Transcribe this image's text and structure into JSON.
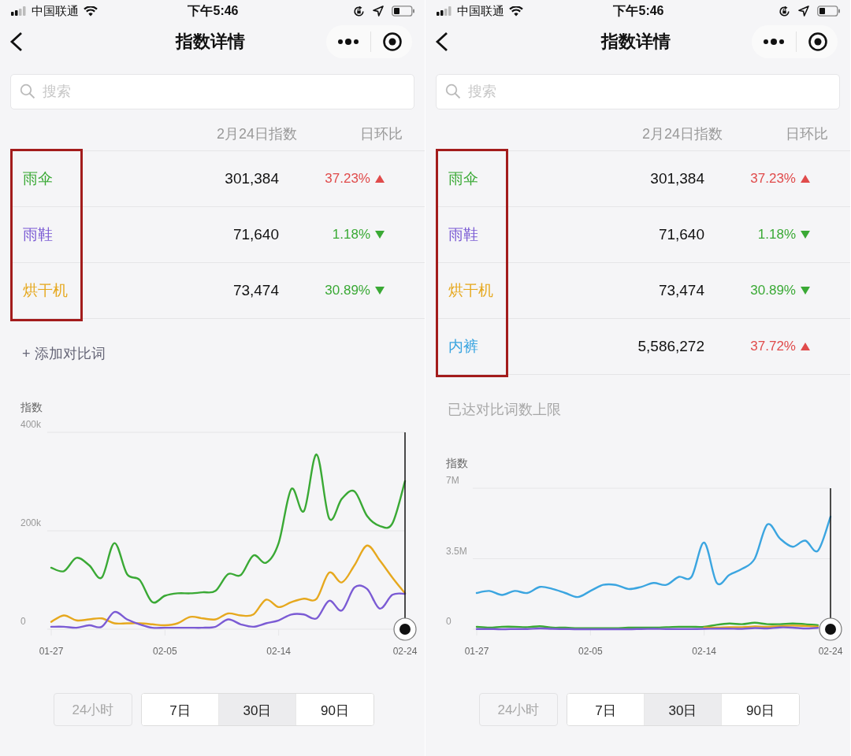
{
  "screens": [
    {
      "status_bar": {
        "carrier": "中国联通",
        "time": "下午5:46"
      },
      "nav": {
        "title": "指数详情"
      },
      "search": {
        "placeholder": "搜索"
      },
      "table": {
        "columns": [
          "2月24日指数",
          "日环比"
        ],
        "highlight_names": true,
        "rows": [
          {
            "name": "雨伞",
            "color": "#3aa935",
            "value": "301,384",
            "change": "37.23%",
            "rising": true
          },
          {
            "name": "雨鞋",
            "color": "#7b5bd4",
            "value": "71,640",
            "change": "1.18%",
            "rising": false
          },
          {
            "name": "烘干机",
            "color": "#e6a81e",
            "value": "73,474",
            "change": "30.89%",
            "rising": false
          }
        ]
      },
      "note": {
        "kind": "add",
        "text": "+ 添加对比词"
      },
      "chart": {
        "chart_data": {
          "type": "line",
          "ylabel": "指数",
          "ylim": [
            0,
            400
          ],
          "categories": [
            "01-27",
            null,
            null,
            null,
            null,
            null,
            null,
            null,
            null,
            "02-05",
            null,
            null,
            null,
            null,
            null,
            null,
            null,
            null,
            "02-14",
            null,
            null,
            null,
            null,
            null,
            null,
            null,
            null,
            null,
            "02-24"
          ],
          "yticks": [
            {
              "value": 0,
              "label": "0"
            },
            {
              "value": 200,
              "label": "200k"
            },
            {
              "value": 400,
              "label": "400k"
            }
          ],
          "series": [
            {
              "color": "#3aa935",
              "values": [
                125,
                118,
                145,
                130,
                105,
                175,
                112,
                100,
                55,
                68,
                73,
                73,
                75,
                78,
                112,
                110,
                150,
                135,
                175,
                285,
                240,
                355,
                225,
                265,
                280,
                230,
                210,
                215,
                301
              ]
            },
            {
              "color": "#e6a81e",
              "values": [
                15,
                28,
                18,
                20,
                22,
                12,
                12,
                12,
                10,
                8,
                12,
                25,
                22,
                20,
                32,
                28,
                30,
                60,
                45,
                55,
                62,
                62,
                115,
                95,
                130,
                170,
                140,
                105,
                73
              ]
            },
            {
              "color": "#7b5bd4",
              "values": [
                5,
                5,
                3,
                8,
                5,
                35,
                20,
                10,
                3,
                3,
                3,
                3,
                3,
                5,
                20,
                10,
                5,
                12,
                18,
                30,
                30,
                22,
                58,
                38,
                85,
                82,
                42,
                70,
                72
              ]
            }
          ]
        }
      },
      "ranges": [
        {
          "label": "24小时",
          "selected": false,
          "disabled": true
        },
        {
          "label": "7日",
          "selected": false,
          "disabled": false
        },
        {
          "label": "30日",
          "selected": true,
          "disabled": false
        },
        {
          "label": "90日",
          "selected": false,
          "disabled": false
        }
      ]
    },
    {
      "status_bar": {
        "carrier": "中国联通",
        "time": "下午5:46"
      },
      "nav": {
        "title": "指数详情"
      },
      "search": {
        "placeholder": "搜索"
      },
      "table": {
        "columns": [
          "2月24日指数",
          "日环比"
        ],
        "highlight_names": true,
        "rows": [
          {
            "name": "雨伞",
            "color": "#3aa935",
            "value": "301,384",
            "change": "37.23%",
            "rising": true
          },
          {
            "name": "雨鞋",
            "color": "#7b5bd4",
            "value": "71,640",
            "change": "1.18%",
            "rising": false
          },
          {
            "name": "烘干机",
            "color": "#e6a81e",
            "value": "73,474",
            "change": "30.89%",
            "rising": false
          },
          {
            "name": "内裤",
            "color": "#3ba5e0",
            "value": "5,586,272",
            "change": "37.72%",
            "rising": true
          }
        ]
      },
      "note": {
        "kind": "limit",
        "text": "已达对比词数上限"
      },
      "chart": {
        "chart_data": {
          "type": "line",
          "ylabel": "指数",
          "ylim": [
            0,
            7
          ],
          "categories": [
            "01-27",
            null,
            null,
            null,
            null,
            null,
            null,
            null,
            null,
            "02-05",
            null,
            null,
            null,
            null,
            null,
            null,
            null,
            null,
            "02-14",
            null,
            null,
            null,
            null,
            null,
            null,
            null,
            null,
            null,
            "02-24"
          ],
          "yticks": [
            {
              "value": 0,
              "label": "0"
            },
            {
              "value": 3.5,
              "label": "3.5M"
            },
            {
              "value": 7,
              "label": "7M"
            }
          ],
          "series": [
            {
              "color": "#3ba5e0",
              "values": [
                1.8,
                1.9,
                1.7,
                1.9,
                1.8,
                2.1,
                2.0,
                1.8,
                1.6,
                1.9,
                2.2,
                2.2,
                2.0,
                2.1,
                2.3,
                2.2,
                2.6,
                2.6,
                4.3,
                2.3,
                2.7,
                3.0,
                3.5,
                5.2,
                4.5,
                4.1,
                4.4,
                3.9,
                5.59
              ]
            },
            {
              "color": "#3aa935",
              "values": [
                0.12,
                0.08,
                0.12,
                0.12,
                0.1,
                0.15,
                0.08,
                0.08,
                0.05,
                0.05,
                0.05,
                0.05,
                0.08,
                0.08,
                0.08,
                0.1,
                0.12,
                0.12,
                0.12,
                0.22,
                0.28,
                0.25,
                0.32,
                0.25,
                0.25,
                0.28,
                0.25,
                0.2,
                null
              ]
            },
            {
              "color": "#e6a81e",
              "values": [
                null,
                null,
                null,
                null,
                null,
                null,
                null,
                null,
                null,
                null,
                null,
                null,
                null,
                null,
                null,
                null,
                null,
                null,
                0.08,
                0.08,
                0.1,
                0.1,
                0.14,
                0.12,
                0.15,
                0.18,
                0.16,
                0.13,
                null
              ]
            },
            {
              "color": "#7b5bd4",
              "values": [
                0.01,
                0.01,
                0,
                0.01,
                0.01,
                0.04,
                0.02,
                0.01,
                0,
                0,
                0,
                0,
                0,
                0.01,
                0.02,
                0.01,
                0.01,
                0.01,
                0.02,
                0.03,
                0.03,
                0.02,
                0.06,
                0.04,
                0.09,
                0.08,
                0.04,
                0.07,
                null
              ]
            }
          ]
        }
      },
      "ranges": [
        {
          "label": "24小时",
          "selected": false,
          "disabled": true
        },
        {
          "label": "7日",
          "selected": false,
          "disabled": false
        },
        {
          "label": "30日",
          "selected": true,
          "disabled": false
        },
        {
          "label": "90日",
          "selected": false,
          "disabled": false
        }
      ]
    }
  ]
}
